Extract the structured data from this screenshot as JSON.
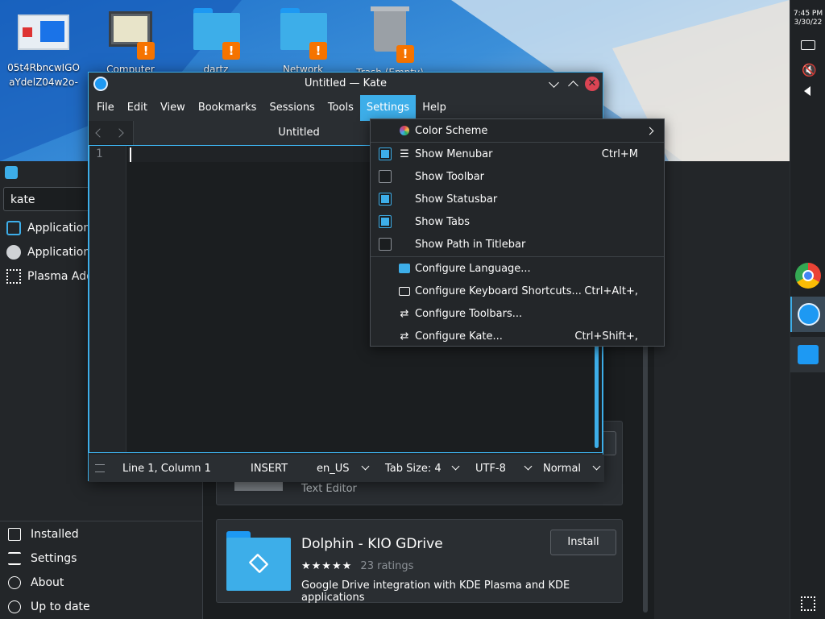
{
  "desktop": {
    "icons": [
      {
        "label_line1": "05t4RbncwIGO",
        "label_line2": "aYdelZ04w2o-"
      },
      {
        "label_line1": "Computer",
        "label_line2": ""
      },
      {
        "label_line1": "dartz",
        "label_line2": ""
      },
      {
        "label_line1": "Network",
        "label_line2": ""
      },
      {
        "label_line1": "Trash (Empty)",
        "label_line2": ""
      }
    ],
    "warning_glyph": "!"
  },
  "panel": {
    "time": "7:45 PM",
    "date": "3/30/22",
    "icons": [
      "keyboard-icon",
      "volume-muted-icon",
      "expand-arrow-icon",
      "chrome-icon",
      "kate-icon",
      "discover-icon",
      "desktop-toggle-icon"
    ]
  },
  "discover": {
    "search_value": "kate",
    "categories": [
      "Applications",
      "Application A",
      "Plasma Add"
    ],
    "bottom_nav": [
      "Installed",
      "Settings",
      "About",
      "Up to date"
    ],
    "partial_card": {
      "subtitle": "Text Editor"
    },
    "card": {
      "title": "Dolphin - KIO GDrive",
      "stars": "★★★★★",
      "ratings": "23 ratings",
      "description": "Google Drive integration with KDE Plasma and KDE applications",
      "install_label": "Install"
    }
  },
  "kate": {
    "title": "Untitled — Kate",
    "menus": [
      "File",
      "Edit",
      "View",
      "Bookmarks",
      "Sessions",
      "Tools",
      "Settings",
      "Help"
    ],
    "active_menu": "Settings",
    "tab_label": "Untitled",
    "line_number": "1",
    "status": {
      "position": "Line 1, Column 1",
      "mode": "INSERT",
      "language": "en_US",
      "tab_size": "Tab Size: 4",
      "encoding": "UTF-8",
      "input_mode": "Normal"
    }
  },
  "settings_menu": {
    "color_scheme": "Color Scheme",
    "checkboxes": [
      {
        "label": "Show Menubar",
        "checked": true,
        "shortcut": "Ctrl+M"
      },
      {
        "label": "Show Toolbar",
        "checked": false,
        "shortcut": ""
      },
      {
        "label": "Show Statusbar",
        "checked": true,
        "shortcut": ""
      },
      {
        "label": "Show Tabs",
        "checked": true,
        "shortcut": ""
      },
      {
        "label": "Show Path in Titlebar",
        "checked": false,
        "shortcut": ""
      }
    ],
    "configure": [
      {
        "label": "Configure Language...",
        "shortcut": ""
      },
      {
        "label": "Configure Keyboard Shortcuts...",
        "shortcut": "Ctrl+Alt+,"
      },
      {
        "label": "Configure Toolbars...",
        "shortcut": ""
      },
      {
        "label": "Configure Kate...",
        "shortcut": "Ctrl+Shift+,"
      }
    ]
  },
  "colors": {
    "accent": "#3daee9",
    "warning": "#f67400",
    "window_bg": "#232629"
  }
}
